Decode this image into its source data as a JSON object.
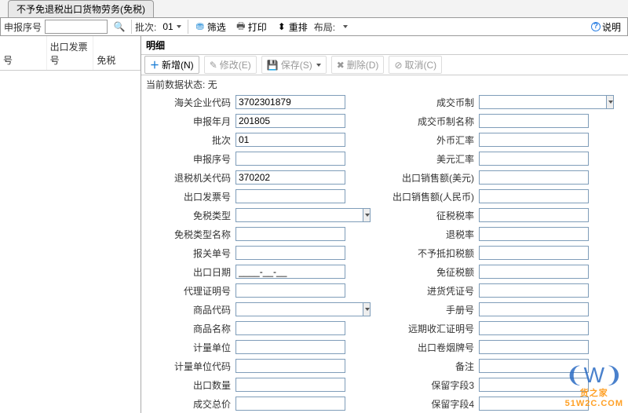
{
  "tab_title": "不予免退税出口货物劳务(免税)",
  "toolbar": {
    "seq_label": "申报序号",
    "seq_value": "",
    "batch_label": "批次:",
    "batch_value": "01",
    "filter": "筛选",
    "print": "打印",
    "reorder": "重排",
    "layout_label": "布局:",
    "help": "说明"
  },
  "left": {
    "col_seq": "号",
    "col_invoice": "出口发票号",
    "col_taxfree": "免税"
  },
  "detail": {
    "title": "明细",
    "buttons": {
      "add": "新增(N)",
      "edit": "修改(E)",
      "save": "保存(S)",
      "delete": "删除(D)",
      "cancel": "取消(C)"
    },
    "status_label": "当前数据状态: ",
    "status_value": "无"
  },
  "form": {
    "left": [
      {
        "label": "海关企业代码",
        "value": "3702301879",
        "type": "text"
      },
      {
        "label": "申报年月",
        "value": "201805",
        "type": "text"
      },
      {
        "label": "批次",
        "value": "01",
        "type": "text"
      },
      {
        "label": "申报序号",
        "value": "",
        "type": "text"
      },
      {
        "label": "退税机关代码",
        "value": "370202",
        "type": "text"
      },
      {
        "label": "出口发票号",
        "value": "",
        "type": "text"
      },
      {
        "label": "免税类型",
        "value": "",
        "type": "combo"
      },
      {
        "label": "免税类型名称",
        "value": "",
        "type": "text"
      },
      {
        "label": "报关单号",
        "value": "",
        "type": "text"
      },
      {
        "label": "出口日期",
        "value": "____-__-__",
        "type": "text"
      },
      {
        "label": "代理证明号",
        "value": "",
        "type": "text"
      },
      {
        "label": "商品代码",
        "value": "",
        "type": "combo"
      },
      {
        "label": "商品名称",
        "value": "",
        "type": "text"
      },
      {
        "label": "计量单位",
        "value": "",
        "type": "text"
      },
      {
        "label": "计量单位代码",
        "value": "",
        "type": "text"
      },
      {
        "label": "出口数量",
        "value": "",
        "type": "text"
      },
      {
        "label": "成交总价",
        "value": "",
        "type": "text"
      }
    ],
    "right": [
      {
        "label": "成交币制",
        "value": "",
        "type": "combo"
      },
      {
        "label": "成交币制名称",
        "value": "",
        "type": "text"
      },
      {
        "label": "外币汇率",
        "value": "",
        "type": "text"
      },
      {
        "label": "美元汇率",
        "value": "",
        "type": "text"
      },
      {
        "label": "出口销售额(美元)",
        "value": "",
        "type": "text"
      },
      {
        "label": "出口销售额(人民币)",
        "value": "",
        "type": "text"
      },
      {
        "label": "征税税率",
        "value": "",
        "type": "text"
      },
      {
        "label": "退税率",
        "value": "",
        "type": "text"
      },
      {
        "label": "不予抵扣税额",
        "value": "",
        "type": "text"
      },
      {
        "label": "免征税额",
        "value": "",
        "type": "text"
      },
      {
        "label": "进货凭证号",
        "value": "",
        "type": "text"
      },
      {
        "label": "手册号",
        "value": "",
        "type": "text"
      },
      {
        "label": "远期收汇证明号",
        "value": "",
        "type": "text"
      },
      {
        "label": "出口卷烟牌号",
        "value": "",
        "type": "text"
      },
      {
        "label": "备注",
        "value": "",
        "type": "text"
      },
      {
        "label": "保留字段3",
        "value": "",
        "type": "text"
      },
      {
        "label": "保留字段4",
        "value": "",
        "type": "text"
      }
    ]
  },
  "watermark": {
    "brand": "货之家",
    "url": "51W2C.COM"
  }
}
